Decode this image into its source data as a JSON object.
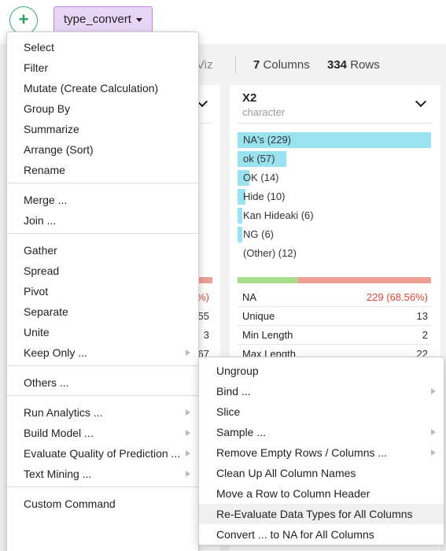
{
  "toolbar": {
    "add_symbol": "+",
    "step_label": "type_convert"
  },
  "stats": {
    "viz_tab": "Viz",
    "columns_count": "7",
    "columns_label": "Columns",
    "rows_count": "334",
    "rows_label": "Rows"
  },
  "left_card": {
    "na_pct_fragment": "%)",
    "values": [
      "55",
      "3",
      "67"
    ]
  },
  "column_x2": {
    "name": "X2",
    "type": "character",
    "bars": [
      {
        "label": "NA's (229)",
        "fraction": 1.0
      },
      {
        "label": "ok (57)",
        "fraction": 0.25
      },
      {
        "label": "OK (14)",
        "fraction": 0.06
      },
      {
        "label": "Hide (10)",
        "fraction": 0.04
      },
      {
        "label": "Kan Hideaki (6)",
        "fraction": 0.026
      },
      {
        "label": "NG (6)",
        "fraction": 0.026
      },
      {
        "label": "(Other) (12)",
        "fraction": 0.0
      }
    ],
    "valid_fraction": 0.3144,
    "stats": [
      {
        "key": "NA",
        "value": "229 (68.56%)",
        "color": "#e0443a"
      },
      {
        "key": "Unique",
        "value": "13"
      },
      {
        "key": "Min Length",
        "value": "2"
      },
      {
        "key": "Max Length",
        "value": "22"
      }
    ]
  },
  "main_menu": {
    "groups": [
      [
        "Select",
        "Filter",
        "Mutate (Create Calculation)",
        "Group By",
        "Summarize",
        "Arrange (Sort)",
        "Rename"
      ],
      [
        "Merge ...",
        "Join ..."
      ],
      [
        "Gather",
        "Spread",
        "Pivot",
        "Separate",
        "Unite",
        "Keep Only ..."
      ],
      [
        "Others ..."
      ],
      [
        "Run Analytics ...",
        "Build Model ...",
        "Evaluate Quality of Prediction ...",
        "Text Mining ..."
      ],
      [
        "Custom Command"
      ]
    ]
  },
  "sub_menu": {
    "items": [
      {
        "label": "Ungroup"
      },
      {
        "label": "Bind ...",
        "has_sub": true
      },
      {
        "label": "Slice"
      },
      {
        "label": "Sample ...",
        "has_sub": true
      },
      {
        "label": "Remove Empty Rows / Columns ...",
        "has_sub": true
      },
      {
        "label": "Clean Up All Column Names"
      },
      {
        "label": "Move a Row to Column Header"
      },
      {
        "label": "Re-Evaluate Data Types for All Columns",
        "highlighted": true
      },
      {
        "label": "Convert ... to NA for All Columns"
      }
    ]
  },
  "colors": {
    "bar": "#99e2f0",
    "na_red": "#f0a197",
    "valid_green": "#a9dd8c",
    "step_bg": "#e6d5f7",
    "add_green": "#2e9e60"
  }
}
